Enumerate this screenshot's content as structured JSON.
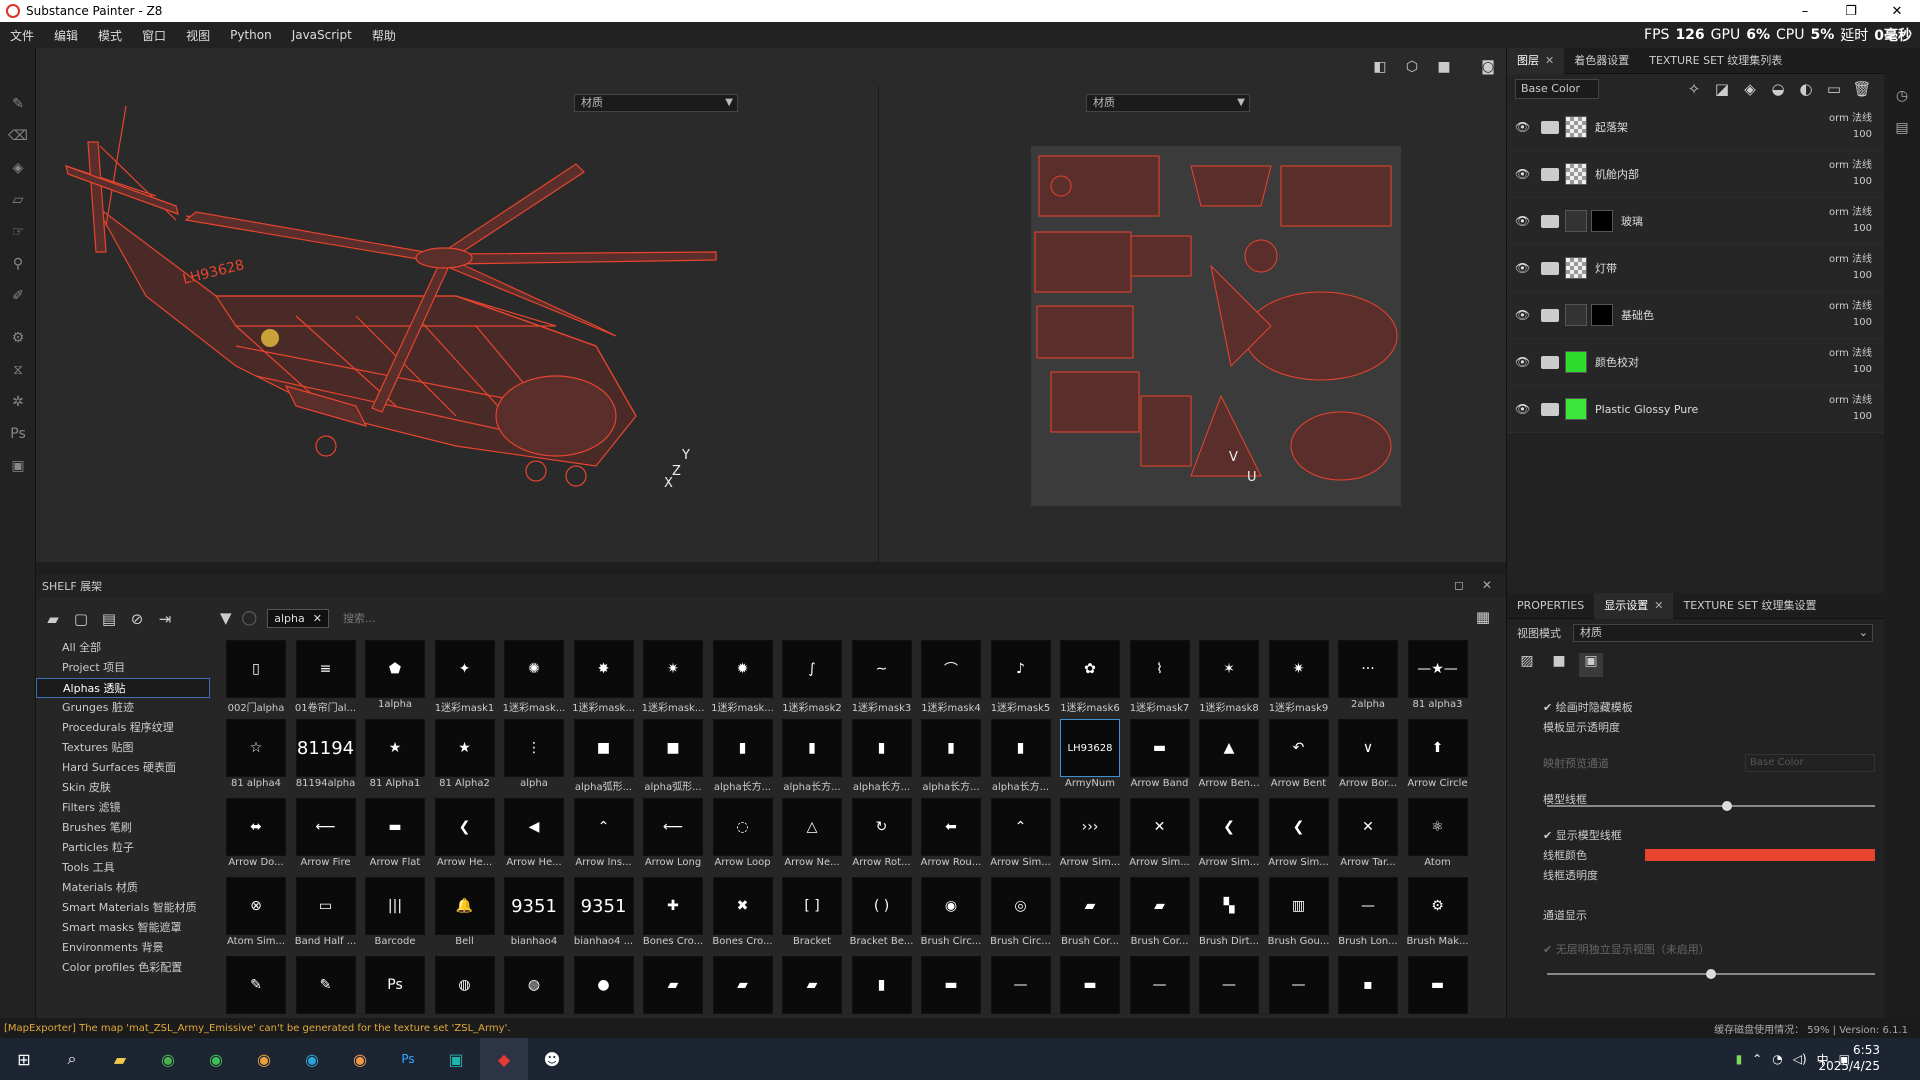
{
  "window": {
    "title": "Substance Painter - Z8",
    "minimize": "–",
    "maximize": "❐",
    "close": "✕"
  },
  "menu": [
    "文件",
    "编辑",
    "模式",
    "窗口",
    "视图",
    "Python",
    "JavaScript",
    "帮助"
  ],
  "stats": {
    "fps_label": "FPS",
    "fps": "126",
    "gpu_label": "GPU",
    "gpu": "6%",
    "cpu_label": "CPU",
    "cpu": "5%",
    "latency_label": "延时",
    "latency": "0毫秒"
  },
  "viewport": {
    "material_left": "材质",
    "material_right": "材质",
    "axes_3d": {
      "y": "Y",
      "z": "Z",
      "x": "X"
    },
    "axes_2d": {
      "v": "V",
      "u": "U"
    },
    "heli_code": "LH93628"
  },
  "right_panel": {
    "tabs": [
      {
        "label": "图层",
        "active": true
      },
      {
        "label": "着色器设置",
        "active": false
      },
      {
        "label": "TEXTURE SET 纹理集列表",
        "active": false
      }
    ],
    "channel": "Base Color",
    "layers": [
      {
        "name": "起落架",
        "blend": "orm 法线",
        "opacity": "100",
        "thumb": "checker",
        "color": "#888"
      },
      {
        "name": "机舱内部",
        "blend": "orm 法线",
        "opacity": "100",
        "thumb": "checker",
        "color": "#888"
      },
      {
        "name": "玻璃",
        "blend": "orm 法线",
        "opacity": "100",
        "thumb": "dark",
        "color": "#333"
      },
      {
        "name": "灯带",
        "blend": "orm 法线",
        "opacity": "100",
        "thumb": "checker",
        "color": "#888"
      },
      {
        "name": "基础色",
        "blend": "orm 法线",
        "opacity": "100",
        "thumb": "dark",
        "color": "#333"
      },
      {
        "name": "颜色校对",
        "blend": "orm 法线",
        "opacity": "100",
        "thumb": "green",
        "color": "#2ddc2d"
      },
      {
        "name": "Plastic Glossy Pure",
        "blend": "orm 法线",
        "opacity": "100",
        "thumb": "green",
        "color": "#3be63b"
      }
    ],
    "lower_tabs": [
      {
        "label": "PROPERTIES",
        "active": false
      },
      {
        "label": "显示设置",
        "active": true
      },
      {
        "label": "TEXTURE SET 纹理集设置",
        "active": false
      }
    ],
    "view_mode_label": "视图模式",
    "view_mode_value": "材质",
    "show_template_label": "绘画时隐藏模板",
    "template_opacity_label": "模板显示透明度",
    "template_opacity": 0.55,
    "mapping_label": "映射预览通道",
    "mapping_value": "Base Color",
    "wireframe_section": "模型线框",
    "show_wireframe_label": "显示模型线框",
    "wire_color_label": "线框颜色",
    "wire_color": "#e8442e",
    "wire_opacity_label": "线框透明度",
    "wire_opacity": 0.5,
    "channel_section": "通道显示",
    "channel_option": "无层明独立显示视图（未启用）"
  },
  "shelf": {
    "title": "SHELF 展架",
    "filter_chip": "alpha",
    "search_placeholder": "搜索...",
    "categories": [
      {
        "label": "All 全部",
        "active": false
      },
      {
        "label": "Project 项目",
        "active": false
      },
      {
        "label": "Alphas 透贴",
        "active": true
      },
      {
        "label": "Grunges 脏迹",
        "active": false
      },
      {
        "label": "Procedurals 程序纹理",
        "active": false
      },
      {
        "label": "Textures 贴图",
        "active": false
      },
      {
        "label": "Hard Surfaces 硬表面",
        "active": false
      },
      {
        "label": "Skin 皮肤",
        "active": false
      },
      {
        "label": "Filters 滤镜",
        "active": false
      },
      {
        "label": "Brushes 笔刷",
        "active": false
      },
      {
        "label": "Particles 粒子",
        "active": false
      },
      {
        "label": "Tools 工具",
        "active": false
      },
      {
        "label": "Materials 材质",
        "active": false
      },
      {
        "label": "Smart Materials 智能材质",
        "active": false
      },
      {
        "label": "Smart masks 智能遮罩",
        "active": false
      },
      {
        "label": "Environments 背景",
        "active": false
      },
      {
        "label": "Color profiles 色彩配置",
        "active": false
      }
    ],
    "rows": [
      [
        {
          "label": "002门alpha",
          "g": "▯"
        },
        {
          "label": "01卷帘门al...",
          "g": "≡"
        },
        {
          "label": "1alpha",
          "g": "⬟"
        },
        {
          "label": "1迷彩mask1",
          "g": "✦"
        },
        {
          "label": "1迷彩mask...",
          "g": "✺"
        },
        {
          "label": "1迷彩mask...",
          "g": "✸"
        },
        {
          "label": "1迷彩mask...",
          "g": "✷"
        },
        {
          "label": "1迷彩mask...",
          "g": "✹"
        },
        {
          "label": "1迷彩mask2",
          "g": "∫"
        },
        {
          "label": "1迷彩mask3",
          "g": "∼"
        },
        {
          "label": "1迷彩mask4",
          "g": "⌒"
        },
        {
          "label": "1迷彩mask5",
          "g": "♪"
        },
        {
          "label": "1迷彩mask6",
          "g": "✿"
        },
        {
          "label": "1迷彩mask7",
          "g": "⌇"
        },
        {
          "label": "1迷彩mask8",
          "g": "✶"
        },
        {
          "label": "1迷彩mask9",
          "g": "✷"
        },
        {
          "label": "2alpha",
          "g": "···"
        },
        {
          "label": "81 alpha3",
          "g": "—★—"
        }
      ],
      [
        {
          "label": "81 alpha4",
          "g": "☆"
        },
        {
          "label": "81194alpha",
          "g": "81194"
        },
        {
          "label": "81 Alpha1",
          "g": "★"
        },
        {
          "label": "81 Alpha2",
          "g": "★"
        },
        {
          "label": "alpha",
          "g": "⋮"
        },
        {
          "label": "alpha弧形...",
          "g": "■"
        },
        {
          "label": "alpha弧形...",
          "g": "■"
        },
        {
          "label": "alpha长方...",
          "g": "▮"
        },
        {
          "label": "alpha长方...",
          "g": "▮"
        },
        {
          "label": "alpha长方...",
          "g": "▮"
        },
        {
          "label": "alpha长方...",
          "g": "▮"
        },
        {
          "label": "alpha长方...",
          "g": "▮"
        },
        {
          "label": "ArmyNum",
          "g": "LH93628"
        },
        {
          "label": "Arrow Band",
          "g": "▬"
        },
        {
          "label": "Arrow Ben...",
          "g": "▲"
        },
        {
          "label": "Arrow Bent",
          "g": "↶"
        },
        {
          "label": "Arrow Bor...",
          "g": "∨"
        },
        {
          "label": "Arrow Circle",
          "g": "⬆"
        }
      ],
      [
        {
          "label": "Arrow Do...",
          "g": "⬌"
        },
        {
          "label": "Arrow Fire",
          "g": "⟵"
        },
        {
          "label": "Arrow Flat",
          "g": "▬"
        },
        {
          "label": "Arrow He...",
          "g": "❮"
        },
        {
          "label": "Arrow He...",
          "g": "◀"
        },
        {
          "label": "Arrow Ins...",
          "g": "⌃"
        },
        {
          "label": "Arrow Long",
          "g": "⟵"
        },
        {
          "label": "Arrow Loop",
          "g": "◌"
        },
        {
          "label": "Arrow Ne...",
          "g": "△"
        },
        {
          "label": "Arrow Rot...",
          "g": "↻"
        },
        {
          "label": "Arrow Rou...",
          "g": "⬅"
        },
        {
          "label": "Arrow Sim...",
          "g": "⌃"
        },
        {
          "label": "Arrow Sim...",
          "g": "›››"
        },
        {
          "label": "Arrow Sim...",
          "g": "✕"
        },
        {
          "label": "Arrow Sim...",
          "g": "❮"
        },
        {
          "label": "Arrow Sim...",
          "g": "❮"
        },
        {
          "label": "Arrow Tar...",
          "g": "✕"
        },
        {
          "label": "Atom",
          "g": "⚛"
        }
      ],
      [
        {
          "label": "Atom Sim...",
          "g": "⊗"
        },
        {
          "label": "Band Half ...",
          "g": "▭"
        },
        {
          "label": "Barcode",
          "g": "|||"
        },
        {
          "label": "Bell",
          "g": "🔔"
        },
        {
          "label": "bianhao4",
          "g": "9351"
        },
        {
          "label": "bianhao4 ...",
          "g": "9351"
        },
        {
          "label": "Bones Cro...",
          "g": "✚"
        },
        {
          "label": "Bones Cro...",
          "g": "✖"
        },
        {
          "label": "Bracket",
          "g": "[ ]"
        },
        {
          "label": "Bracket Be...",
          "g": "( )"
        },
        {
          "label": "Brush Circ...",
          "g": "◉"
        },
        {
          "label": "Brush Circ...",
          "g": "◎"
        },
        {
          "label": "Brush Cor...",
          "g": "▰"
        },
        {
          "label": "Brush Cor...",
          "g": "▰"
        },
        {
          "label": "Brush Dirt...",
          "g": "▚"
        },
        {
          "label": "Brush Gou...",
          "g": "▥"
        },
        {
          "label": "Brush Lon...",
          "g": "—"
        },
        {
          "label": "Brush Mak...",
          "g": "⚙"
        }
      ],
      [
        {
          "label": "",
          "g": "✎"
        },
        {
          "label": "",
          "g": "✎"
        },
        {
          "label": "",
          "g": "Ps"
        },
        {
          "label": "",
          "g": "◍"
        },
        {
          "label": "",
          "g": "◍"
        },
        {
          "label": "",
          "g": "●"
        },
        {
          "label": "",
          "g": "▰"
        },
        {
          "label": "",
          "g": "▰"
        },
        {
          "label": "",
          "g": "▰"
        },
        {
          "label": "",
          "g": "▮"
        },
        {
          "label": "",
          "g": "▬"
        },
        {
          "label": "",
          "g": "—"
        },
        {
          "label": "",
          "g": "▬"
        },
        {
          "label": "",
          "g": "—"
        },
        {
          "label": "",
          "g": "—"
        },
        {
          "label": "",
          "g": "—"
        },
        {
          "label": "",
          "g": "▪"
        },
        {
          "label": "",
          "g": "▬"
        }
      ]
    ]
  },
  "status": {
    "message": "[MapExporter] The map 'mat_ZSL_Army_Emissive' can't be generated for the texture set 'ZSL_Army'.",
    "disk": "缓存磁盘使用情况：",
    "disk_pct": "59%",
    "version": "Version: 6.1.1"
  },
  "taskbar": {
    "time": "6:53",
    "date": "2025/4/25",
    "ime": "中"
  }
}
